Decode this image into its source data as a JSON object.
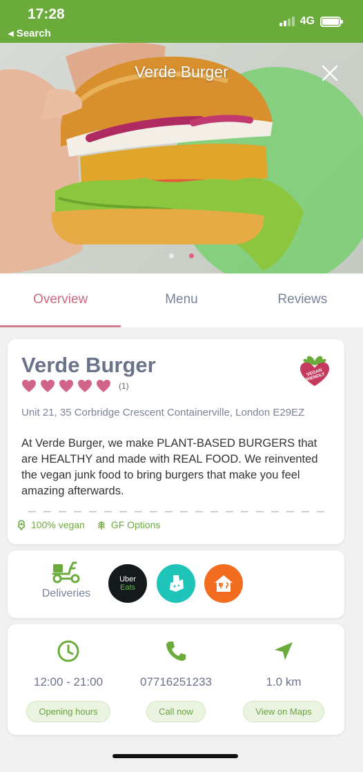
{
  "status_bar": {
    "time": "17:28",
    "back_label": "◂ Search",
    "network": "4G"
  },
  "hero": {
    "title": "Verde Burger",
    "image_desc": "burger-photo",
    "slide_count": 2,
    "active_slide": 2
  },
  "tabs": [
    {
      "label": "Overview",
      "active": true
    },
    {
      "label": "Menu",
      "active": false
    },
    {
      "label": "Reviews",
      "active": false
    }
  ],
  "restaurant": {
    "name": "Verde Burger",
    "rating": 5,
    "rating_count": "(1)",
    "address": "Unit 21, 35 Corbridge Crescent Containerville, London E29EZ",
    "description": "At Verde Burger, we make PLANT-BASED BURGERS that are HEALTHY and made with REAL FOOD. We reinvented the vegan junk food to bring burgers that make you feel amazing afterwards.",
    "badge": "vegan-friendly-badge",
    "tags": [
      {
        "icon": "vegan-leaf-icon",
        "label": "100% vegan"
      },
      {
        "icon": "wheat-icon",
        "label": "GF Options"
      }
    ]
  },
  "deliveries": {
    "label": "Deliveries",
    "providers": [
      {
        "name": "uber-eats",
        "line1": "Uber",
        "line2": "Eats"
      },
      {
        "name": "deliveroo"
      },
      {
        "name": "just-eat"
      }
    ]
  },
  "contact": {
    "hours": {
      "value": "12:00 - 21:00",
      "button": "Opening hours"
    },
    "phone": {
      "value": "07716251233",
      "button": "Call now"
    },
    "distance": {
      "value": "1.0 km",
      "button": "View on Maps"
    }
  },
  "colors": {
    "brand_green": "#6bab3c",
    "accent_pink": "#d47b92",
    "heart_pink": "#d2648a"
  }
}
